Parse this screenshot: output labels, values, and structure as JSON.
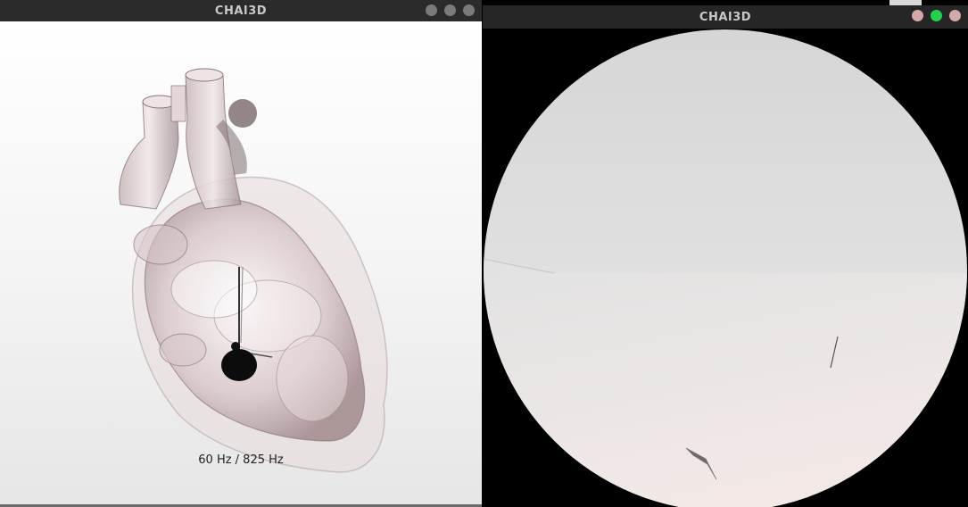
{
  "left_window": {
    "title": "CHAI3D",
    "frame_rate_label": "60 Hz / 825 Hz"
  },
  "right_window": {
    "title": "CHAI3D"
  },
  "colors": {
    "titlebar": "#2b2b2b",
    "title_text": "#c9c9c9",
    "close_button_inactive": "#7a7a7a",
    "maximize_button_active": "#21d24a",
    "min_button_active": "#d4a8a8"
  }
}
